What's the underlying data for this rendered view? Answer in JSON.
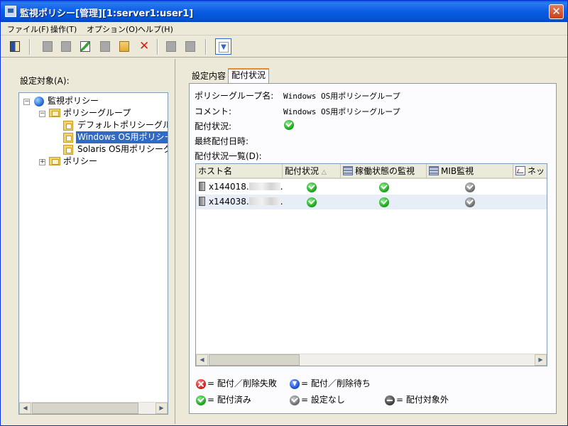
{
  "window": {
    "title": "監視ポリシー[管理][1:server1:user1]",
    "close": "✕"
  },
  "menu": [
    "ファイル(F)",
    "操作(T)",
    "オプション(O)",
    "ヘルプ(H)"
  ],
  "left": {
    "label": "設定対象(A):",
    "tree": [
      {
        "label": "監視ポリシー",
        "expander": "−"
      },
      {
        "label": "ポリシーグループ",
        "expander": "−"
      },
      {
        "label": "デフォルトポリシーグル"
      },
      {
        "label": "Windows OS用ポリシーグ",
        "selected": true
      },
      {
        "label": "Solaris OS用ポリシーグ"
      },
      {
        "label": "ポリシー",
        "expander": "+"
      }
    ]
  },
  "right": {
    "tabs": [
      "設定内容",
      "配付状況"
    ],
    "active_tab": "配付状況",
    "info": {
      "group_label": "ポリシーグループ名:",
      "group_value": "Windows OS用ポリシーグループ",
      "comment_label": "コメント:",
      "comment_value": "Windows OS用ポリシーグループ",
      "status_label": "配付状況:",
      "status_value": "ok",
      "last_label": "最終配付日時:",
      "list_label": "配付状況一覧(D):"
    },
    "grid": {
      "columns": [
        "ホスト名",
        "配付状況",
        "稼働状態の監視",
        "MIB監視",
        "ネッ"
      ],
      "sort_indicator": "△",
      "rows": [
        {
          "host_prefix": "x144018.",
          "host_suffix": "...",
          "status": [
            "ok",
            "ok",
            "none"
          ]
        },
        {
          "host_prefix": "x144038.",
          "host_suffix": "...",
          "status": [
            "ok",
            "ok",
            "none"
          ]
        }
      ]
    },
    "legend": [
      {
        "icon": "fail",
        "text": "= 配付／削除失敗"
      },
      {
        "icon": "wait",
        "text": "= 配付／削除待ち"
      },
      {
        "icon": "ok",
        "text": "= 配付済み"
      },
      {
        "icon": "none",
        "text": "= 設定なし"
      },
      {
        "icon": "excl",
        "text": "= 配付対象外"
      }
    ]
  },
  "colors": {
    "title_bar": "#0a5ce4",
    "selection": "#316ac5",
    "active_tab_accent": "#e68b2c"
  }
}
